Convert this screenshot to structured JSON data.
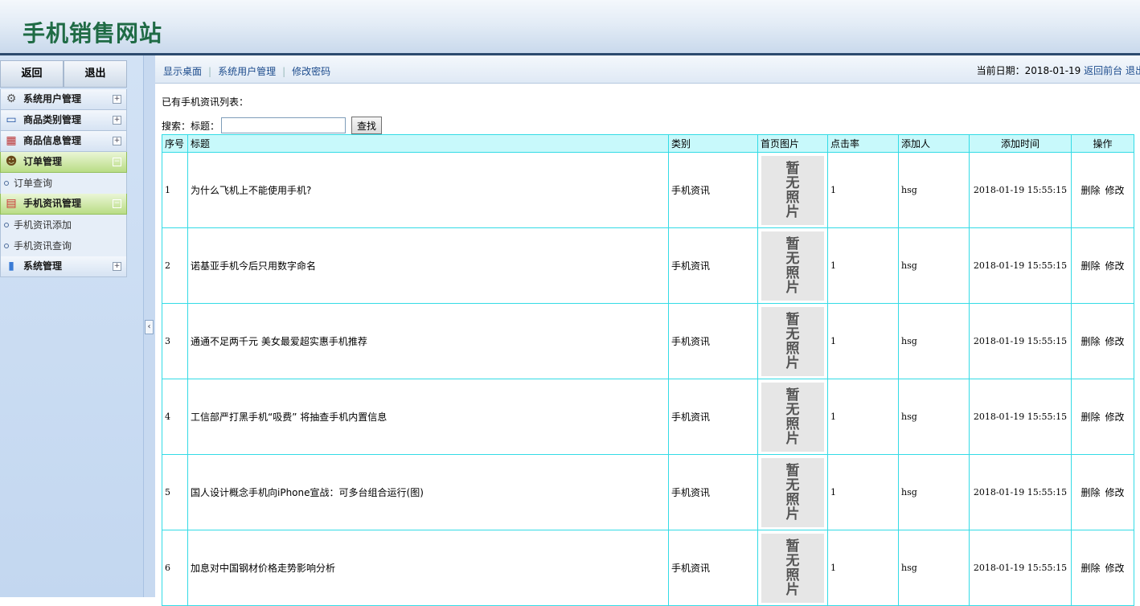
{
  "header": {
    "site_title": "手机销售网站"
  },
  "sidebar": {
    "back_label": "返回",
    "logout_label": "退出",
    "menus": [
      {
        "label": "系统用户管理",
        "icon": "gear-icon",
        "expanded": false,
        "items": []
      },
      {
        "label": "商品类别管理",
        "icon": "monitor-icon",
        "expanded": false,
        "items": []
      },
      {
        "label": "商品信息管理",
        "icon": "table-icon",
        "expanded": false,
        "items": []
      },
      {
        "label": "订单管理",
        "icon": "user-icon",
        "expanded": true,
        "items": [
          "订单查询"
        ]
      },
      {
        "label": "手机资讯管理",
        "icon": "calendar-icon",
        "expanded": true,
        "items": [
          "手机资讯添加",
          "手机资讯查询"
        ]
      },
      {
        "label": "系统管理",
        "icon": "chart-icon",
        "expanded": false,
        "items": []
      }
    ],
    "toggle_collapsed": "+",
    "toggle_expanded": "−",
    "collapse_glyph": "‹"
  },
  "topbar": {
    "links": [
      "显示桌面",
      "系统用户管理",
      "修改密码"
    ],
    "date_label": "当前日期：2018-01-19",
    "front_link": "返回前台",
    "exit_link": "退出"
  },
  "list_title": "已有手机资讯列表：",
  "search": {
    "label": "搜索：",
    "field_label": "标题：",
    "value": "",
    "button": "查找"
  },
  "table": {
    "headers": [
      "序号",
      "标题",
      "类别",
      "首页图片",
      "点击率",
      "添加人",
      "添加时间",
      "操作"
    ],
    "photo_text": [
      "暂",
      "无",
      "照",
      "片"
    ],
    "delete_label": "删除",
    "edit_label": "修改",
    "rows": [
      {
        "no": "1",
        "title": "为什么飞机上不能使用手机?",
        "category": "手机资讯",
        "clicks": "1",
        "author": "hsg",
        "time": "2018-01-19 15:55:15"
      },
      {
        "no": "2",
        "title": "诺基亚手机今后只用数字命名",
        "category": "手机资讯",
        "clicks": "1",
        "author": "hsg",
        "time": "2018-01-19 15:55:15"
      },
      {
        "no": "3",
        "title": "通通不足两千元 美女最爱超实惠手机推荐",
        "category": "手机资讯",
        "clicks": "1",
        "author": "hsg",
        "time": "2018-01-19 15:55:15"
      },
      {
        "no": "4",
        "title": "工信部严打黑手机“吸费” 将抽查手机内置信息",
        "category": "手机资讯",
        "clicks": "1",
        "author": "hsg",
        "time": "2018-01-19 15:55:15"
      },
      {
        "no": "5",
        "title": "国人设计概念手机向iPhone宣战：可多台组合运行(图)",
        "category": "手机资讯",
        "clicks": "1",
        "author": "hsg",
        "time": "2018-01-19 15:55:15"
      },
      {
        "no": "6",
        "title": "加息对中国钢材价格走势影响分析",
        "category": "手机资讯",
        "clicks": "1",
        "author": "hsg",
        "time": "2018-01-19 15:55:15"
      }
    ]
  }
}
